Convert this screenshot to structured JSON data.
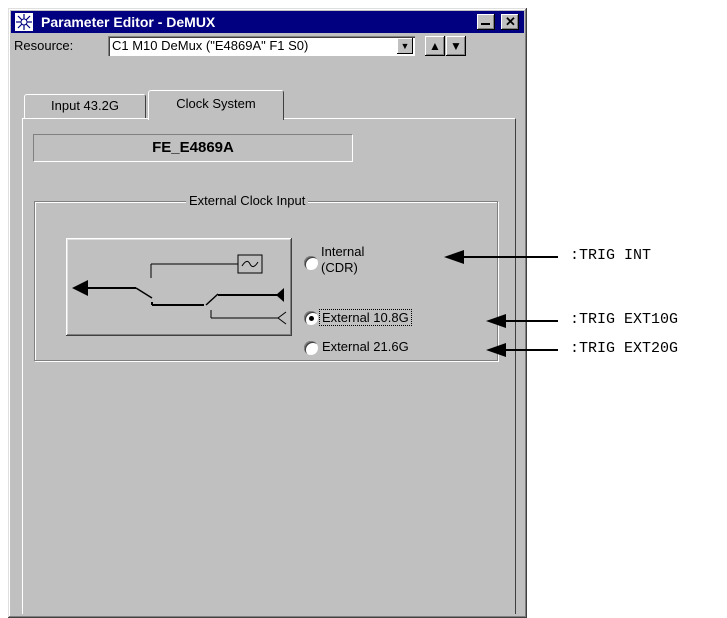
{
  "window": {
    "title": "Parameter Editor - DeMUX"
  },
  "resource": {
    "label": "Resource:",
    "value": "C1 M10 DeMux (\"E4869A\" F1 S0)"
  },
  "tabs": [
    {
      "label": "Input 43.2G",
      "selected": false
    },
    {
      "label": "Clock System",
      "selected": true
    }
  ],
  "module_name": "FE_E4869A",
  "group": {
    "title": "External Clock Input",
    "options": [
      {
        "label_line1": "Internal",
        "label_line2": "(CDR)",
        "selected": false
      },
      {
        "label": "External 10.8G",
        "selected": true
      },
      {
        "label": "External 21.6G",
        "selected": false
      }
    ]
  },
  "annotations": [
    {
      "command": ":TRIG INT"
    },
    {
      "command": ":TRIG EXT10G"
    },
    {
      "command": ":TRIG EXT20G"
    }
  ],
  "icons": [
    "app-icon",
    "minimize-icon",
    "close-icon",
    "dropdown-arrow-icon",
    "up-arrow-icon",
    "down-arrow-icon"
  ]
}
